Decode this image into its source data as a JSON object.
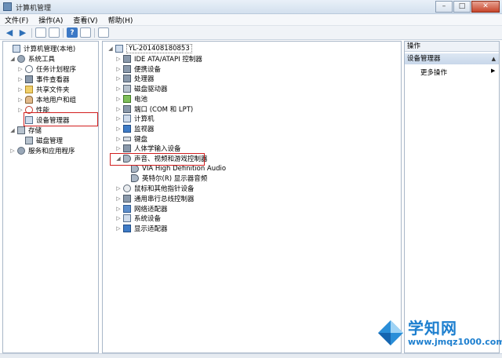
{
  "window": {
    "title": "计算机管理"
  },
  "menu": [
    "文件(F)",
    "操作(A)",
    "查看(V)",
    "帮助(H)"
  ],
  "left_tree": [
    {
      "label": "计算机管理(本地)",
      "icon": "computer-icon",
      "expander": ""
    },
    {
      "label": "系统工具",
      "icon": "tools-icon",
      "expander": "◢"
    },
    {
      "label": "任务计划程序",
      "icon": "clock-icon",
      "expander": "▷"
    },
    {
      "label": "事件查看器",
      "icon": "event-viewer-icon",
      "expander": "▷"
    },
    {
      "label": "共享文件夹",
      "icon": "folder-icon",
      "expander": "▷"
    },
    {
      "label": "本地用户和组",
      "icon": "users-icon",
      "expander": "▷"
    },
    {
      "label": "性能",
      "icon": "performance-icon",
      "expander": "▷"
    },
    {
      "label": "设备管理器",
      "icon": "device-manager-icon",
      "expander": ""
    },
    {
      "label": "存储",
      "icon": "storage-icon",
      "expander": "◢"
    },
    {
      "label": "磁盘管理",
      "icon": "disk-icon",
      "expander": ""
    },
    {
      "label": "服务和应用程序",
      "icon": "services-icon",
      "expander": "▷"
    }
  ],
  "device_tree": {
    "root": "YL-201408180853",
    "items": [
      {
        "label": "IDE ATA/ATAPI 控制器",
        "icon": "ide-icon",
        "expander": "▷"
      },
      {
        "label": "便携设备",
        "icon": "portable-device-icon",
        "expander": "▷"
      },
      {
        "label": "处理器",
        "icon": "processor-icon",
        "expander": "▷"
      },
      {
        "label": "磁盘驱动器",
        "icon": "disk-drive-icon",
        "expander": "▷"
      },
      {
        "label": "电池",
        "icon": "battery-icon",
        "expander": "▷"
      },
      {
        "label": "端口 (COM 和 LPT)",
        "icon": "port-icon",
        "expander": "▷"
      },
      {
        "label": "计算机",
        "icon": "computer-icon",
        "expander": "▷"
      },
      {
        "label": "监视器",
        "icon": "monitor-icon",
        "expander": "▷"
      },
      {
        "label": "键盘",
        "icon": "keyboard-icon",
        "expander": "▷"
      },
      {
        "label": "人体学输入设备",
        "icon": "hid-icon",
        "expander": "▷"
      },
      {
        "label": "声音、视频和游戏控制器",
        "icon": "speaker-icon",
        "expander": "◢"
      },
      {
        "label": "VIA High Definition Audio",
        "icon": "speaker-icon",
        "expander": ""
      },
      {
        "label": "英特尔(R) 显示器音频",
        "icon": "speaker-icon",
        "expander": ""
      },
      {
        "label": "鼠标和其他指针设备",
        "icon": "mouse-icon",
        "expander": "▷"
      },
      {
        "label": "通用串行总线控制器",
        "icon": "usb-icon",
        "expander": "▷"
      },
      {
        "label": "网络适配器",
        "icon": "network-icon",
        "expander": "▷"
      },
      {
        "label": "系统设备",
        "icon": "system-device-icon",
        "expander": "▷"
      },
      {
        "label": "显示适配器",
        "icon": "display-icon",
        "expander": "▷"
      }
    ]
  },
  "actions": {
    "title": "操作",
    "header": "设备管理器",
    "more": "更多操作"
  },
  "watermark": {
    "name": "学知网",
    "url": "www.jmqz1000.com"
  },
  "colors": {
    "highlight": "#d21f1f",
    "accent": "#1d7fcf"
  }
}
